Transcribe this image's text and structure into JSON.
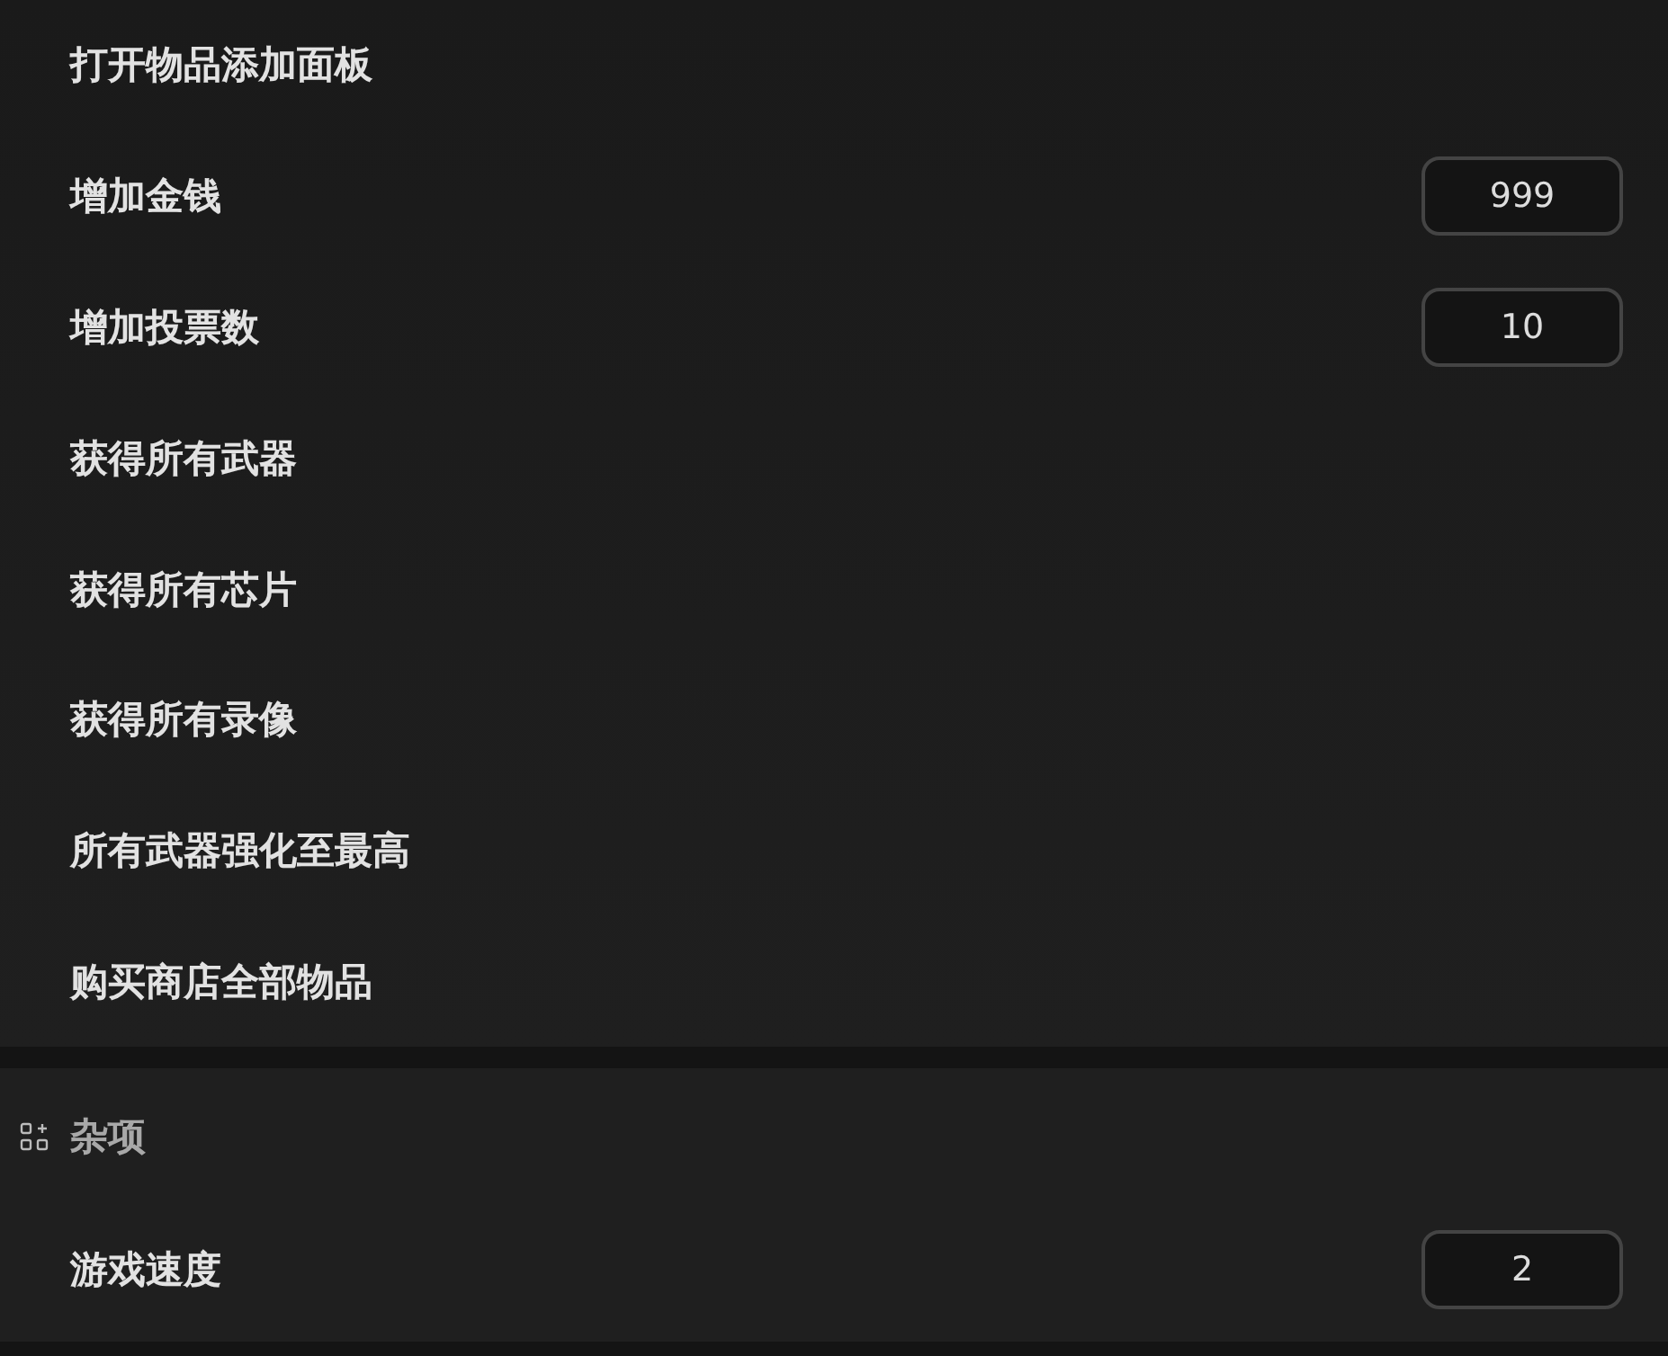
{
  "sections": [
    {
      "items": [
        {
          "kind": "action",
          "label": "打开物品添加面板"
        },
        {
          "kind": "number",
          "label": "增加金钱",
          "value": "999"
        },
        {
          "kind": "number",
          "label": "增加投票数",
          "value": "10"
        },
        {
          "kind": "action",
          "label": "获得所有武器"
        },
        {
          "kind": "action",
          "label": "获得所有芯片"
        },
        {
          "kind": "action",
          "label": "获得所有录像"
        },
        {
          "kind": "action",
          "label": "所有武器强化至最高"
        },
        {
          "kind": "action",
          "label": "购买商店全部物品"
        }
      ]
    },
    {
      "title": "杂项",
      "items": [
        {
          "kind": "number",
          "label": "游戏速度",
          "value": "2"
        }
      ]
    }
  ]
}
